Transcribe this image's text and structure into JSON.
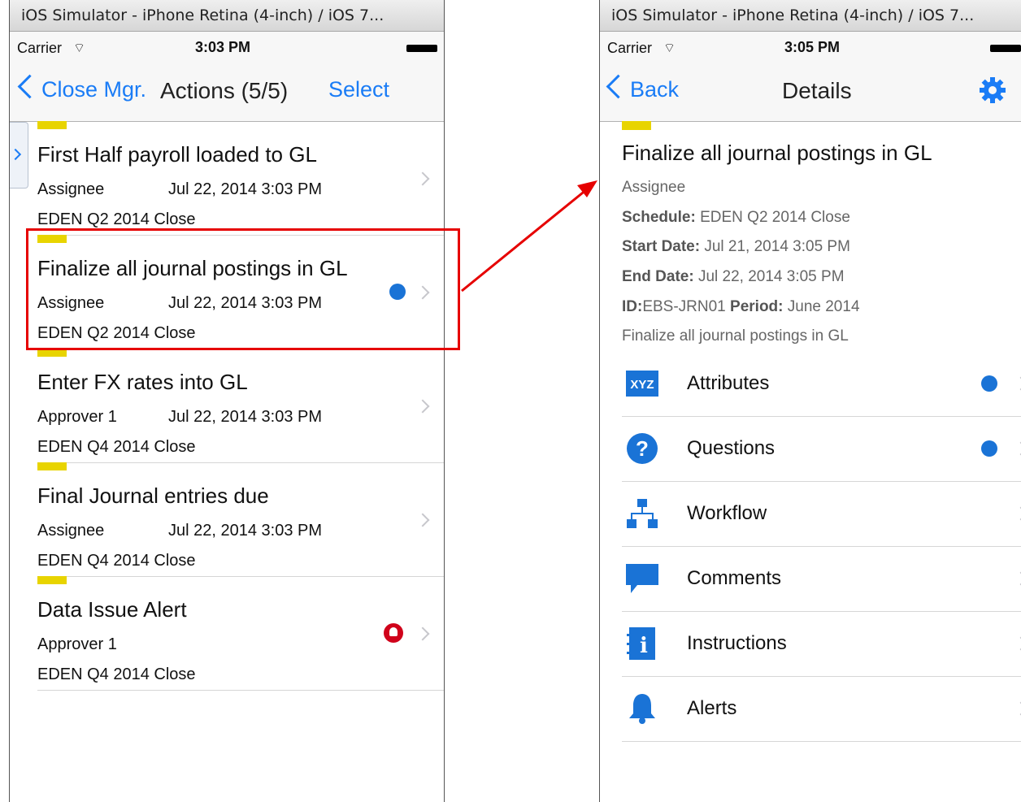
{
  "left": {
    "window_title": "iOS Simulator - iPhone Retina (4-inch) / iOS 7...",
    "carrier": "Carrier",
    "time": "3:03 PM",
    "back_label": "Close Mgr.",
    "title": "Actions (5/5)",
    "select_label": "Select",
    "rows": [
      {
        "title": "First Half payroll loaded to GL",
        "role": "Assignee",
        "date": "Jul 22, 2014 3:03 PM",
        "schedule": "EDEN Q2 2014 Close"
      },
      {
        "title": "Finalize all journal postings in GL",
        "role": "Assignee",
        "date": "Jul 22, 2014 3:03 PM",
        "schedule": "EDEN Q2 2014 Close"
      },
      {
        "title": "Enter FX rates into GL",
        "role": "Approver 1",
        "date": "Jul 22, 2014 3:03 PM",
        "schedule": "EDEN Q4 2014 Close"
      },
      {
        "title": "Final Journal entries due",
        "role": "Assignee",
        "date": "Jul 22, 2014 3:03 PM",
        "schedule": "EDEN Q4 2014 Close"
      },
      {
        "title": "Data Issue Alert",
        "role": "Approver 1",
        "schedule": "EDEN Q4 2014 Close"
      }
    ]
  },
  "right": {
    "window_title": "iOS Simulator - iPhone Retina (4-inch) / iOS 7...",
    "carrier": "Carrier",
    "time": "3:05 PM",
    "back_label": "Back",
    "title": "Details",
    "detail": {
      "title": "Finalize all journal postings in GL",
      "role": "Assignee",
      "schedule_label": "Schedule:",
      "schedule_value": "EDEN Q2 2014 Close",
      "start_label": "Start Date:",
      "start_value": "Jul 21, 2014 3:05 PM",
      "end_label": "End Date:",
      "end_value": "Jul 22, 2014 3:05 PM",
      "id_label": "ID:",
      "id_value": "EBS-JRN01",
      "period_label": "Period:",
      "period_value": "June 2014",
      "description": "Finalize all journal postings in GL"
    },
    "menu": [
      {
        "label": "Attributes",
        "icon": "xyz-icon",
        "icon_text": "XYZ"
      },
      {
        "label": "Questions",
        "icon": "question-icon",
        "icon_text": "?"
      },
      {
        "label": "Workflow",
        "icon": "workflow-icon"
      },
      {
        "label": "Comments",
        "icon": "comment-icon"
      },
      {
        "label": "Instructions",
        "icon": "instructions-icon",
        "icon_text": "i"
      },
      {
        "label": "Alerts",
        "icon": "bell-icon"
      }
    ]
  },
  "colors": {
    "ios_blue": "#1a7cf6",
    "icon_blue": "#1a73d6",
    "stripe_yellow": "#e8d400",
    "highlight_red": "#e60000",
    "alert_red": "#d0021b"
  }
}
